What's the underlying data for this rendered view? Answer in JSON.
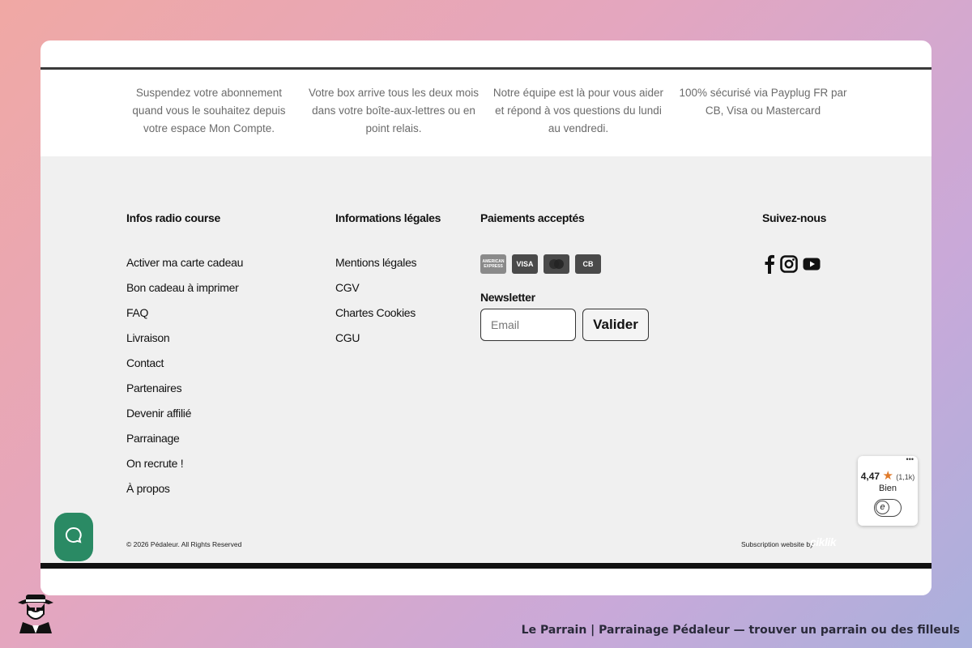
{
  "features": [
    "Suspendez votre abonnement quand vous le souhaitez depuis votre espace Mon Compte.",
    "Votre box arrive tous les deux mois dans votre boîte-aux-lettres ou en point relais.",
    "Notre équipe est là pour vous aider et répond à vos questions du lundi au vendredi.",
    "100% sécurisé via Payplug FR par CB, Visa ou Mastercard"
  ],
  "footer": {
    "col1": {
      "title": "Infos radio course",
      "links": [
        "Activer ma carte cadeau",
        "Bon cadeau à imprimer",
        "FAQ",
        "Livraison",
        "Contact",
        "Partenaires",
        "Devenir affilié",
        "Parrainage",
        "On recrute !",
        "À propos"
      ]
    },
    "col2": {
      "title": "Informations légales",
      "links": [
        "Mentions légales",
        "CGV",
        "Chartes Cookies",
        "CGU"
      ]
    },
    "payments": {
      "title": "Paiements acceptés",
      "cards": {
        "amex": "AMERICAN EXPRESS",
        "visa": "VISA",
        "mastercard": "mastercard",
        "cb": "CB"
      }
    },
    "newsletter": {
      "title": "Newsletter",
      "placeholder": "Email",
      "submit_label": "Valider"
    },
    "social": {
      "title": "Suivez-nous",
      "icons": [
        "facebook-icon",
        "instagram-icon",
        "youtube-icon"
      ]
    },
    "copyright": "© 2026 Pédaleur. All Rights Reserved",
    "credit": "Subscription website by",
    "credit_logo": "ciklik"
  },
  "rating_widget": {
    "score": "4,47",
    "count": "(1,1k)",
    "label": "Bien",
    "badge": "e"
  },
  "caption": "Le Parrain | Parrainage Pédaleur — trouver un parrain ou des filleuls",
  "colors": {
    "chat_button": "#2a8a64",
    "footer_bg": "#f0f0f0",
    "star": "#e07a2a"
  }
}
